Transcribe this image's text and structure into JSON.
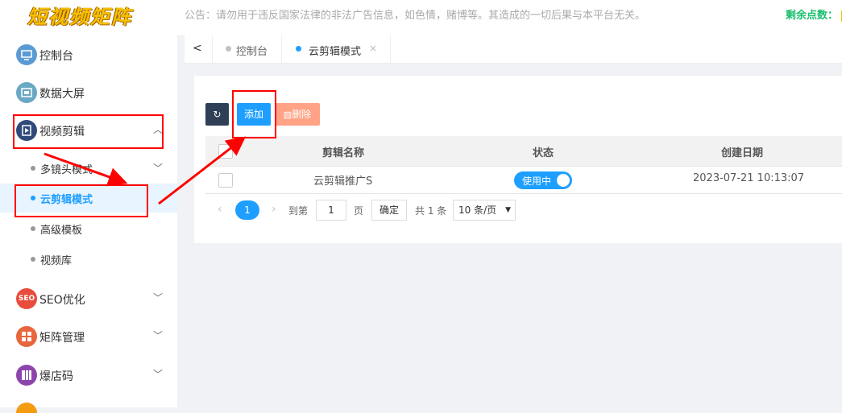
{
  "app": {
    "logo": "短视频矩阵",
    "notice": "公告：请勿用于违反国家法律的非法广告信息，如色情，赌博等。其造成的一切后果与本平台无关。",
    "points_label": "剩余点数："
  },
  "sidebar": {
    "items": [
      {
        "label": "控制台",
        "icon": "monitor-icon",
        "color": "#5b9bd5"
      },
      {
        "label": "数据大屏",
        "icon": "fullscreen-icon",
        "color": "#6aa8c4"
      },
      {
        "label": "视频剪辑",
        "icon": "video-edit-icon",
        "color": "#2f4a7a"
      },
      {
        "label": "SEO优化",
        "icon": "SEO",
        "color": "#e84c3d"
      },
      {
        "label": "矩阵管理",
        "icon": "matrix-icon",
        "color": "#e8663d"
      },
      {
        "label": "爆店码",
        "icon": "grid-icon",
        "color": "#8e44ad"
      }
    ],
    "sub_items": [
      {
        "label": "多镜头模式"
      },
      {
        "label": "云剪辑模式"
      },
      {
        "label": "高级模板"
      },
      {
        "label": "视频库"
      }
    ]
  },
  "tabs": [
    {
      "label": "控制台",
      "dot_color": "#c2c2c2"
    },
    {
      "label": "云剪辑模式",
      "dot_color": "#1e9fff",
      "close": "×"
    }
  ],
  "toolbar": {
    "refresh_icon": "↻",
    "add_label": "添加",
    "delete_label": "删除",
    "delete_icon": "🗑"
  },
  "table": {
    "headers": [
      "剪辑名称",
      "状态",
      "创建日期"
    ],
    "rows": [
      {
        "name": "云剪辑推广S",
        "status": "使用中",
        "created": "2023-07-21 10:13:07"
      }
    ]
  },
  "pagination": {
    "prev": "‹",
    "current": "1",
    "next": "›",
    "goto_label": "到第",
    "goto_value": "1",
    "page_label": "页",
    "confirm_label": "确定",
    "total": "共 1 条",
    "page_size": "10 条/页"
  },
  "colors": {
    "accent": "#1e9fff",
    "annotation": "#ff0000"
  }
}
